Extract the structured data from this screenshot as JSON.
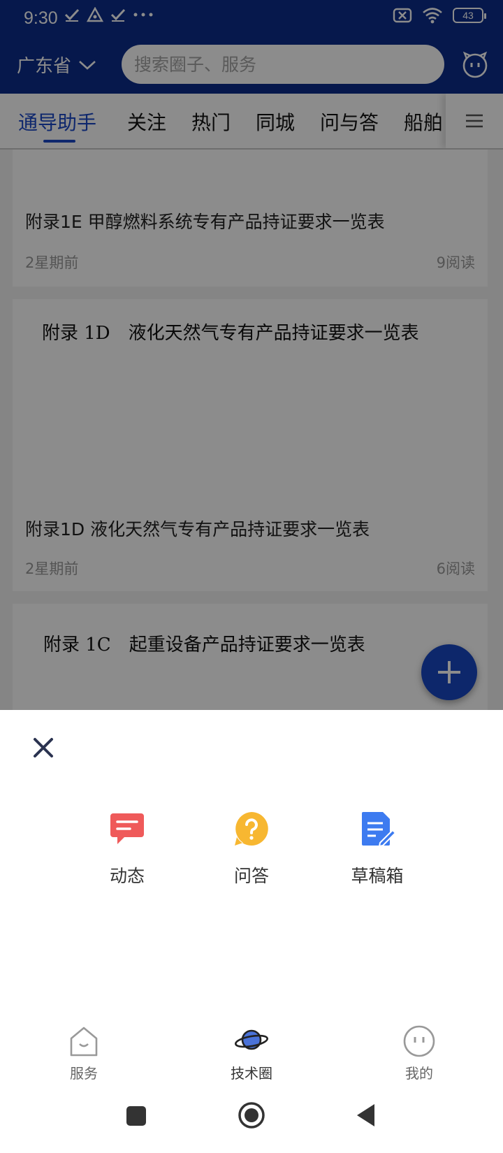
{
  "status_bar": {
    "time": "9:30",
    "battery": "43",
    "icons_left": [
      "check-icon",
      "triangle-alert-icon",
      "check-icon",
      "more-dots-icon"
    ],
    "icons_right": [
      "sim-off-icon",
      "wifi-icon",
      "battery-icon"
    ]
  },
  "header": {
    "province": "广东省",
    "search_placeholder": "搜索圈子、服务"
  },
  "tabs": {
    "items": [
      "通导助手",
      "关注",
      "热门",
      "同城",
      "问与答",
      "船舶"
    ],
    "active_index": 0
  },
  "feed": {
    "cards": [
      {
        "title": "附录1E 甲醇燃料系统专有产品持证要求一览表",
        "time": "2星期前",
        "reads": "9阅读"
      },
      {
        "image_title": "附录 1D　液化天然气专有产品持证要求一览表",
        "title": "附录1D 液化天然气专有产品持证要求一览表",
        "time": "2星期前",
        "reads": "6阅读"
      },
      {
        "image_title": "附录 1C　起重设备产品持证要求一览表"
      }
    ]
  },
  "sheet": {
    "actions": [
      {
        "label": "动态",
        "icon": "chat-bubble-icon",
        "color": "#ef5a5a"
      },
      {
        "label": "问答",
        "icon": "question-icon",
        "color": "#f7b731"
      },
      {
        "label": "草稿箱",
        "icon": "draft-document-icon",
        "color": "#3d7bf0"
      }
    ]
  },
  "bottom_nav": {
    "items": [
      {
        "label": "服务",
        "icon": "home-smile-icon"
      },
      {
        "label": "技术圈",
        "icon": "planet-icon"
      },
      {
        "label": "我的",
        "icon": "face-icon"
      }
    ],
    "active_index": 1
  },
  "colors": {
    "brand": "#0c2d8a",
    "accent": "#1a47c6"
  }
}
